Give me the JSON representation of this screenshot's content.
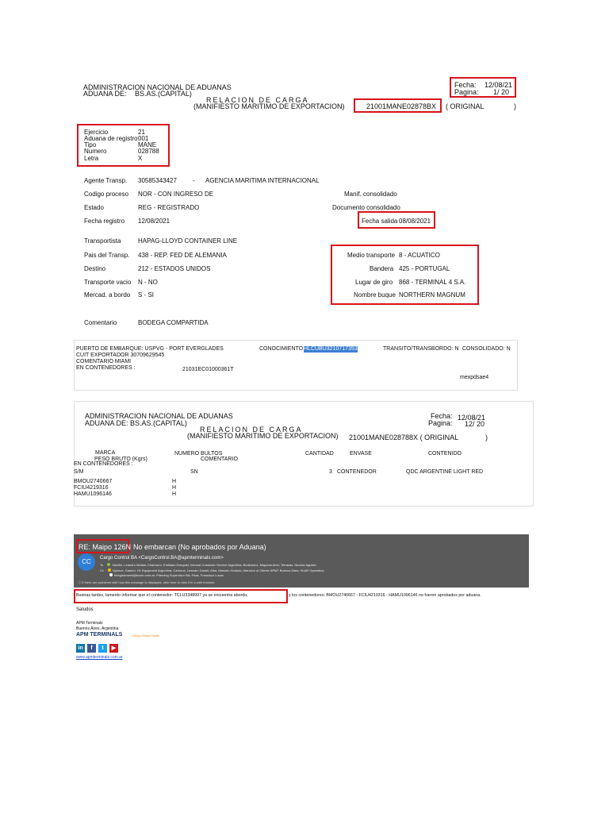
{
  "doc1": {
    "admin": "ADMINISTRACION NACIONAL DE ADUANAS",
    "aduana_label": "ADUANA DE:",
    "aduana_value": "BS.AS.(CAPITAL)",
    "relacion": "RELACION DE CARGA",
    "manifiesto": "(MANIFIESTO MARITIMO DE EXPORTACION)",
    "manifest_id": "21001MANE02878BX",
    "original": "( ORIGINAL",
    "close_paren": ")",
    "fecha_label": "Fecha:",
    "fecha_value": "12/08/21",
    "pagina_label": "Pagina:",
    "pagina_value": "1/ 20",
    "ejercicio_label": "Ejercicio",
    "ejercicio_value": "21",
    "aduana_registro_label": "Aduana de registro",
    "aduana_registro_value": "001",
    "tipo_label": "Tipo",
    "tipo_value": "MANE",
    "numero_label": "Numero",
    "numero_value": "028788",
    "letra_label": "Letra",
    "letra_value": "X",
    "agente_label": "Agente Transp.",
    "agente_code": "30585343427",
    "agente_dash": "-",
    "agente_name": "AGENCIA MARITIMA INTERNACIONAL",
    "codigo_label": "Codigo proceso",
    "codigo_value": "NOR  -  CON INGRESO DE",
    "manif_consolidado": "Manif. consolidado",
    "estado_label": "Estado",
    "estado_value": "REG  -  REGISTRADO",
    "doc_consolidado": "Documento consolidado",
    "fecha_registro_label": "Fecha registro",
    "fecha_registro_value": "12/08/2021",
    "fecha_salida_label": "Fecha salida",
    "fecha_salida_value": "08/08/2021",
    "transportista_label": "Transportista",
    "transportista_value": "HAPAG-LLOYD CONTAINER LINE",
    "pais_label": "Pais del Transp.",
    "pais_value": "438  -  REP. FED DE ALEMANIA",
    "destino_label": "Destino",
    "destino_value": "212  -  ESTADOS UNIDOS",
    "vacio_label": "Transporte vacio",
    "vacio_value": "N -    NO",
    "mercad_label": "Mercad. a bordo",
    "mercad_value": "S -    SI",
    "medio_label": "Medio transporte",
    "medio_value": "8  -  ACUATICO",
    "bandera_label": "Bandera",
    "bandera_value": "425  -  PORTUGAL",
    "lugar_label": "Lugar de giro",
    "lugar_value": "868  -  TERMINAL 4 S.A.",
    "buque_label": "Nombre buque",
    "buque_value": "NORTHERN MAGNUM",
    "comentario_label": "Comentario",
    "comentario_value": "BODEGA COMPARTIDA"
  },
  "strip": {
    "puerto": "PUERTO DE EMBARQUE: USPVG  - PORT EVERGLADES",
    "conocimiento_label": "CONOCIMIENTO",
    "conocimiento_value": "HLCUBU3210717353",
    "transito": "TRANSITO/TRANSBORDO: N",
    "consolidado": "CONSOLIDADO: N",
    "cuit": "CUIT EXPORTADOR      30709629545",
    "comentario": "COMENTARIO                 MIAMI",
    "contenedores": "EN CONTENEDORES :",
    "cont_value": "21031EC01000361T",
    "footer": "mexpdsae4"
  },
  "doc2": {
    "admin": "ADMINISTRACION NACIONAL DE ADUANAS",
    "aduana": "ADUANA DE:   BS.AS.(CAPITAL)",
    "relacion": "RELACION DE CARGA",
    "manifiesto": "(MANIFIESTO MARITIMO DE EXPORTACION)",
    "manifest_line": "21001MANE028788X    (  ORIGINAL",
    "close_paren": ")",
    "fecha_label": "Fecha:",
    "fecha_value": "12/08/21",
    "pagina_label": "Pagina:",
    "pagina_value": "12/ 20",
    "col_marca": "MARCA",
    "col_peso": "PESO BRUTO (Kgrs)",
    "col_bultos": "NUMERO BULTOS",
    "col_comentario": "COMENTARIO",
    "col_cantidad": "CANTIDAD",
    "col_envase": "ENVASE",
    "col_contenido": "CONTENIDO",
    "en_contenedores": "EN CONTENEDORES :",
    "row_marca": "S/M",
    "row_bultos": "SN",
    "row_cantidad": "3",
    "row_envase": "CONTENEDOR",
    "row_contenido": "QDC ARGENTINE LIGHT RED",
    "containers": [
      {
        "id": "BMOU2740667",
        "flag": "H"
      },
      {
        "id": "FCIU4219316",
        "flag": "H"
      },
      {
        "id": "HAMU1096146",
        "flag": "H"
      }
    ]
  },
  "email": {
    "subject_boxed": "RE: Maipo 126N",
    "subject_rest": "No embarcan (No aprobados por Aduana)",
    "avatar": "CC",
    "sender": "Cargo Control BA <CargoControl.BA@apmterminals.com>",
    "to_label": "To",
    "to_list": "Salzillo, Leandro Matias;  Chamorro, Emiliano Ezequiel;  Internal Customer Service Argentina;  Bonilowicz, Miqueas Abel;  Terrazas, Nicolas Agustin",
    "cc_label": "Cc",
    "cc_list": "Spence, Gaston;  HL Equipment Argentina;  Carbone, Leandro Daniel;  Alba, Marcelo Horacio;  Atencion al Cliente APMT Buenos Aires;  HLAR Operation;",
    "cc_list2": "hlregistroweb@bcom.com.ar;  Planning Supervisor BA;  Frias, Francisco Lucas",
    "problems": "If there are problems with how this message is displayed, click here to view it in a web browser.",
    "body_boxed": "Buenas tardes, lamento informar que el contenedor: TCLU3348997 ya se encuentra abordo,",
    "body_rest": "y los contenedores: BMOU2740667 - FCIU4219316 - HAMU1096146 no fueron aprobados por aduana.",
    "saludos": "Saludos",
    "sig_company": "APM Terminals",
    "sig_city": "Buenos Aires, Argentina",
    "sig_logo": "APM TERMINALS",
    "sig_tagline": "Lifting Global Trade",
    "social": [
      {
        "label": "in",
        "color": "#0e76a8"
      },
      {
        "label": "f",
        "color": "#3b5998"
      },
      {
        "label": "t",
        "color": "#1da1f2"
      },
      {
        "label": "▶",
        "color": "#cc181e"
      }
    ],
    "website": "www.apmterminals.com.ar"
  }
}
